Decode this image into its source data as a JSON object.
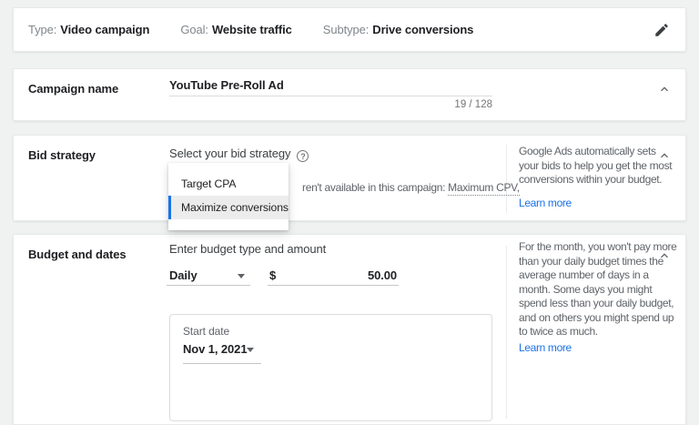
{
  "colors": {
    "accent_blue": "#1a73e8",
    "link_blue": "#1a73e8",
    "text_primary": "#202124",
    "text_secondary": "#5f6368",
    "selected_option_bg": "#ececec",
    "page_background": "#f0f2f2"
  },
  "icons": {
    "edit": "pencil-icon",
    "collapse": "chevron-up-icon",
    "help": "question-mark-circle-icon",
    "select": "triangle-down-caret-icon"
  },
  "summary_bar": {
    "items": [
      {
        "label": "Type:",
        "value": "Video campaign"
      },
      {
        "label": "Goal:",
        "value": "Website traffic"
      },
      {
        "label": "Subtype:",
        "value": "Drive conversions"
      }
    ]
  },
  "campaign_name": {
    "section_label": "Campaign name",
    "value": "YouTube Pre-Roll Ad",
    "char_count": "19 / 128"
  },
  "bid_strategy": {
    "section_label": "Bid strategy",
    "field_label": "Select your bid strategy",
    "help_icon_glyph": "?",
    "dropdown_options": [
      {
        "label": "Target CPA",
        "selected": false
      },
      {
        "label": "Maximize conversions",
        "selected": true
      }
    ],
    "clipped_text": "ren't available in this campaign:",
    "clipped_text_underlined": "Maximum CPV,",
    "help_panel": {
      "text": "Google Ads automatically sets\nyour bids to help you get the most\nconversions within your budget.",
      "link_label": "Learn more"
    }
  },
  "budget_and_dates": {
    "section_label": "Budget and dates",
    "field_label": "Enter budget type and amount",
    "budget_type": "Daily",
    "currency_symbol": "$",
    "amount": "50.00",
    "start_date": {
      "label": "Start date",
      "value": "Nov 1, 2021"
    },
    "help_panel": {
      "text": "For the month, you won't pay more\nthan your daily budget times the\naverage number of days in a\nmonth. Some days you might\nspend less than your daily budget,\nand on others you might spend up\nto twice as much.",
      "link_label": "Learn more"
    }
  }
}
